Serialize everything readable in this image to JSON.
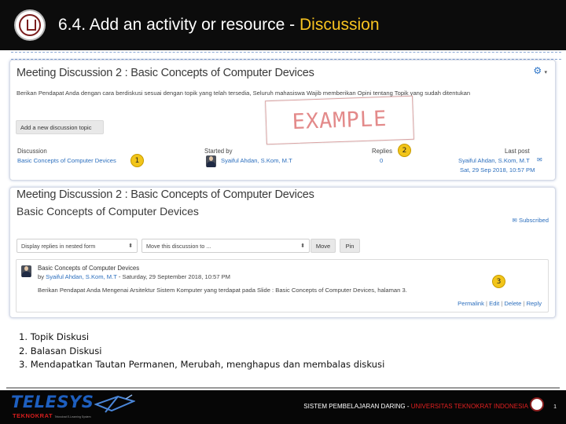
{
  "slide": {
    "title_main": "6.4. Add an activity or resource - ",
    "title_accent": "Discussion"
  },
  "panel_top": {
    "title": "Meeting Discussion 2 : Basic Concepts of Computer Devices",
    "settings_icon": "gear-icon",
    "description": "Berikan Pendapat Anda dengan cara berdiskusi sesuai dengan topik yang telah tersedia, Seluruh mahasiswa Wajib memberikan Opini tentang Topik yang sudah ditentukan",
    "add_button": "Add a new discussion topic",
    "stamp": "EXAMPLE",
    "headers": {
      "discussion": "Discussion",
      "started_by": "Started by",
      "replies": "Replies",
      "last_post": "Last post"
    },
    "row": {
      "discussion": "Basic Concepts of Computer Devices",
      "started_by": "Syaiful Ahdan, S.Kom, M.T",
      "replies": "0",
      "last_post_author": "Syaiful Ahdan, S.Kom, M.T",
      "last_post_date": "Sat, 29 Sep 2018, 10:57 PM",
      "mail_icon": "envelope-icon"
    }
  },
  "panel_bottom": {
    "title": "Meeting Discussion 2 : Basic Concepts of Computer Devices",
    "subtitle": "Basic Concepts of Computer Devices",
    "subscribed": "Subscribed",
    "display_select": "Display replies in nested form",
    "move_select": "Move this discussion to ...",
    "move_button": "Move",
    "pin_button": "Pin",
    "post": {
      "subject": "Basic Concepts of Computer Devices",
      "by_prefix": "by ",
      "author": "Syaiful Ahdan, S.Kom, M.T",
      "date": " - Saturday, 29 September 2018, 10:57 PM",
      "body": "Berikan Pendapat Anda Mengenai Arsitektur Sistem Komputer yang terdapat pada Slide : Basic Concepts of Computer Devices, halaman 3.",
      "actions": {
        "permalink": "Permalink",
        "edit": "Edit",
        "delete": "Delete",
        "reply": "Reply"
      }
    }
  },
  "badges": [
    "1",
    "2",
    "3"
  ],
  "legend": [
    "1. Topik Diskusi",
    "2. Balasan Diskusi",
    "3. Mendapatkan Tautan Permanen, Merubah, menghapus dan membalas diskusi"
  ],
  "footer": {
    "brand": "TELESYS",
    "brand_sub": "TEKNOKRAT",
    "brand_tagline": "Teknokrat E-Learning System",
    "text_white": "SISTEM PEMBELAJARAN DARING -",
    "text_red": "UNIVERSITAS TEKNOKRAT INDONESIA",
    "page_number": "1"
  },
  "colors": {
    "header_bg": "#0c0c0c",
    "title_accent": "#f7c320",
    "link": "#2c6fbe",
    "badge": "#f2c51a",
    "brand_blue": "#1e5fbf",
    "brand_red": "#d81e1e"
  }
}
